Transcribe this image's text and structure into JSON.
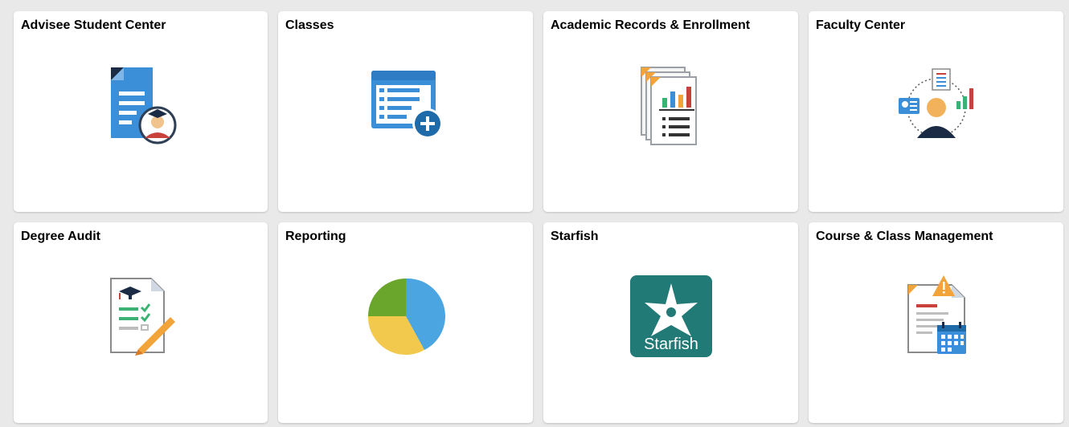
{
  "tiles": [
    {
      "title": "Advisee Student Center",
      "icon": "advisee-student-center-icon"
    },
    {
      "title": "Classes",
      "icon": "classes-icon"
    },
    {
      "title": "Academic Records & Enrollment",
      "icon": "academic-records-icon"
    },
    {
      "title": "Faculty Center",
      "icon": "faculty-center-icon"
    },
    {
      "title": "Degree Audit",
      "icon": "degree-audit-icon"
    },
    {
      "title": "Reporting",
      "icon": "reporting-pie-chart-icon"
    },
    {
      "title": "Starfish",
      "icon": "starfish-logo-icon",
      "logo_text": "Starfish"
    },
    {
      "title": "Course & Class Management",
      "icon": "course-class-management-icon"
    }
  ],
  "colors": {
    "page_bg": "#e9e9e9",
    "tile_bg": "#ffffff",
    "blue": "#3b8fd9",
    "dark_blue": "#1f6aa8",
    "orange": "#f2a33a",
    "red": "#c8413a",
    "green": "#3bb273",
    "teal": "#217a76",
    "yellow": "#f2c94c"
  }
}
